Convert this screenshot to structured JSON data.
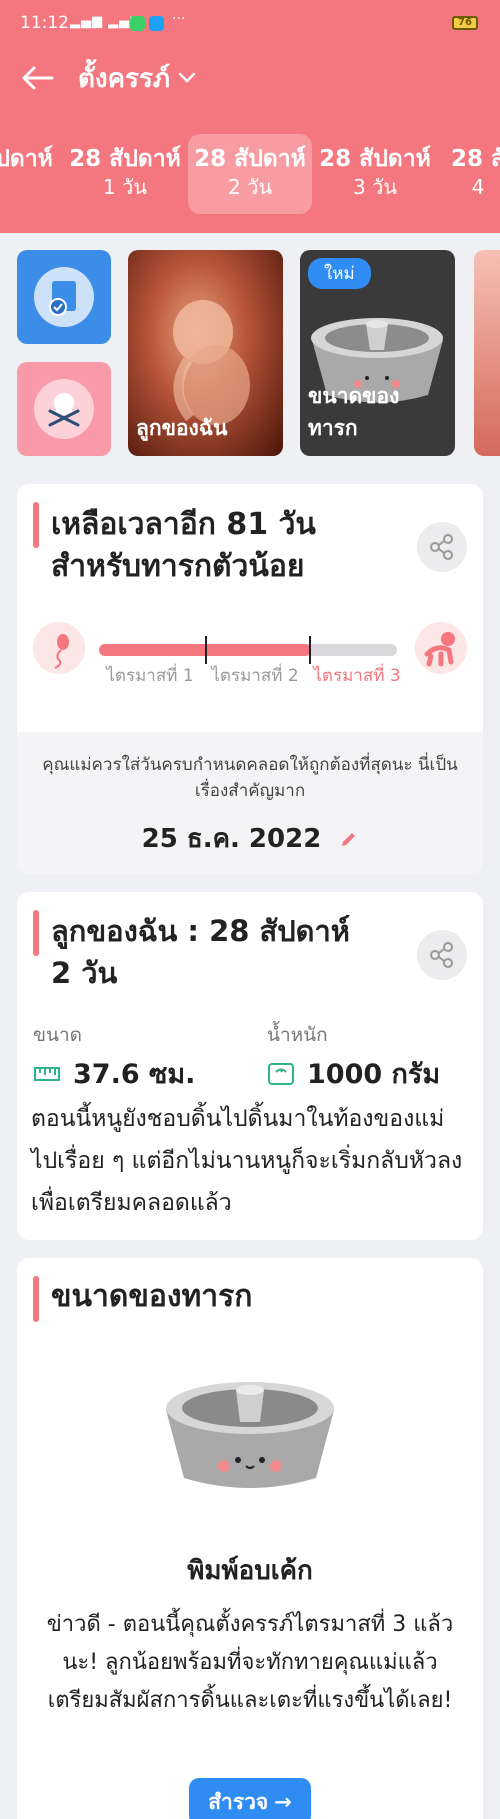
{
  "status": {
    "time": "11:12",
    "battery": "76"
  },
  "header": {
    "title": "ตั้งครรภ์"
  },
  "weeks": [
    {
      "w": "ปดาห์",
      "d": ""
    },
    {
      "w": "28 สัปดาห์",
      "d": "1 วัน"
    },
    {
      "w": "28 สัปดาห์",
      "d": "2 วัน"
    },
    {
      "w": "28 สัปดาห์",
      "d": "3 วัน"
    },
    {
      "w": "28 สั",
      "d": "4"
    }
  ],
  "shortcuts": {
    "card1_label": "ลูกของฉัน",
    "card2_badge": "ใหม่",
    "card2_label": "ขนาดของทารก"
  },
  "countdown": {
    "line1": "เหลือเวลาอีก 81 วัน",
    "line2": "สำหรับทารกตัวน้อย",
    "tri1": "ไตรมาสที่ 1",
    "tri2": "ไตรมาสที่ 2",
    "tri3": "ไตรมาสที่ 3",
    "progress": 0.71,
    "message": "คุณแม่ควรใส่วันครบกำหนดคลอดให้ถูกต้องที่สุดนะ นี่เป็นเรื่องสำคัญมาก",
    "due_date": "25 ธ.ค. 2022"
  },
  "baby": {
    "line1": "ลูกของฉัน : 28 สัปดาห์",
    "line2": "2  วัน",
    "size_label": "ขนาด",
    "size_value": "37.6 ซม.",
    "weight_label": "น้ำหนัก",
    "weight_value": "1000 กรัม",
    "description": "ตอนนี้หนูยังชอบดิ้นไปดิ้นมาในท้องของแม่ไปเรื่อย ๆ แต่อีกไม่นานหนูก็จะเริ่มกลับหัวลงเพื่อเตรียมคลอดแล้ว"
  },
  "size_card": {
    "title": "ขนาดของทารก",
    "object_name": "พิมพ์อบเค้ก",
    "text": "ข่าวดี - ตอนนี้คุณตั้งครรภ์ไตรมาสที่ 3 แล้วนะ! ลูกน้อยพร้อมที่จะทักทายคุณแม่แล้ว เตรียมสัมผัสการดิ้นและเตะที่แรงขึ้นได้เลย!",
    "button": "สำรวจ"
  },
  "colors": {
    "brand": "#f4767e",
    "accent": "#2f8cf2"
  }
}
